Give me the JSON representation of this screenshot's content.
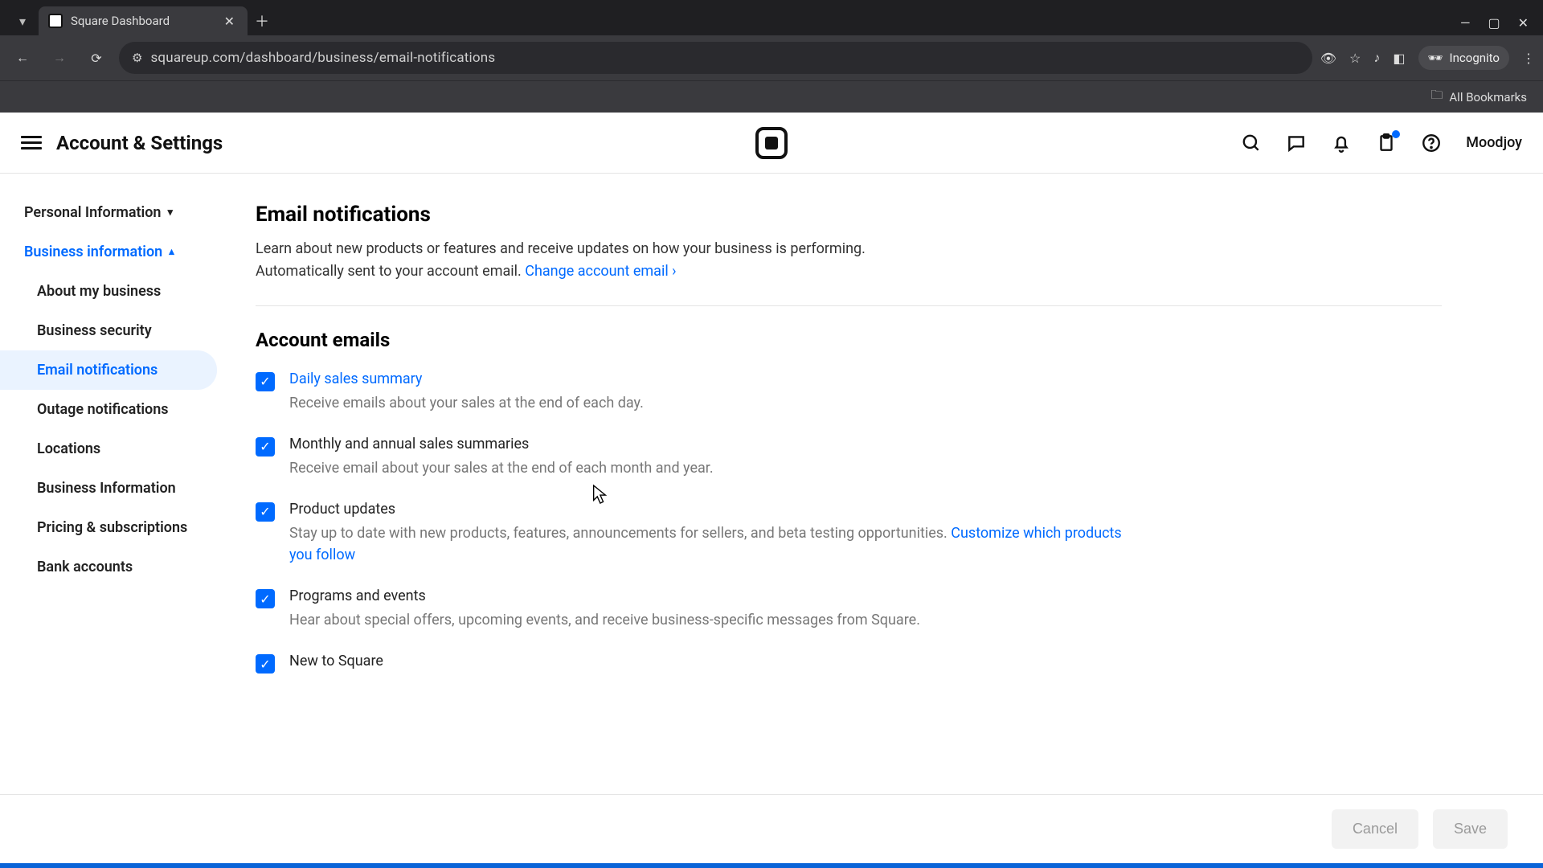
{
  "browser": {
    "tab_title": "Square Dashboard",
    "url": "squareup.com/dashboard/business/email-notifications",
    "incognito_label": "Incognito",
    "bookmarks_label": "All Bookmarks"
  },
  "appbar": {
    "title": "Account & Settings",
    "username": "Moodjoy"
  },
  "sidebar": {
    "section_personal": "Personal Information",
    "section_business": "Business information",
    "items": [
      {
        "label": "About my business"
      },
      {
        "label": "Business security"
      },
      {
        "label": "Email notifications"
      },
      {
        "label": "Outage notifications"
      },
      {
        "label": "Locations"
      },
      {
        "label": "Business Information"
      },
      {
        "label": "Pricing & subscriptions"
      },
      {
        "label": "Bank accounts"
      }
    ]
  },
  "page": {
    "title": "Email notifications",
    "desc": "Learn about new products or features and receive updates on how your business is performing. Automatically sent to your account email. ",
    "change_email_link": "Change account email ›",
    "section_account_emails": "Account emails",
    "options": [
      {
        "label": "Daily sales summary",
        "desc": "Receive emails about your sales at the end of each day.",
        "label_is_link": true
      },
      {
        "label": "Monthly and annual sales summaries",
        "desc": "Receive email about your sales at the end of each month and year."
      },
      {
        "label": "Product updates",
        "desc": "Stay up to date with new products, features, announcements for sellers, and beta testing opportunities. ",
        "trailing_link": "Customize which products you follow"
      },
      {
        "label": "Programs and events",
        "desc": "Hear about special offers, upcoming events, and receive business-specific messages from Square."
      },
      {
        "label": "New to Square",
        "desc": ""
      }
    ]
  },
  "footer": {
    "cancel": "Cancel",
    "save": "Save"
  }
}
